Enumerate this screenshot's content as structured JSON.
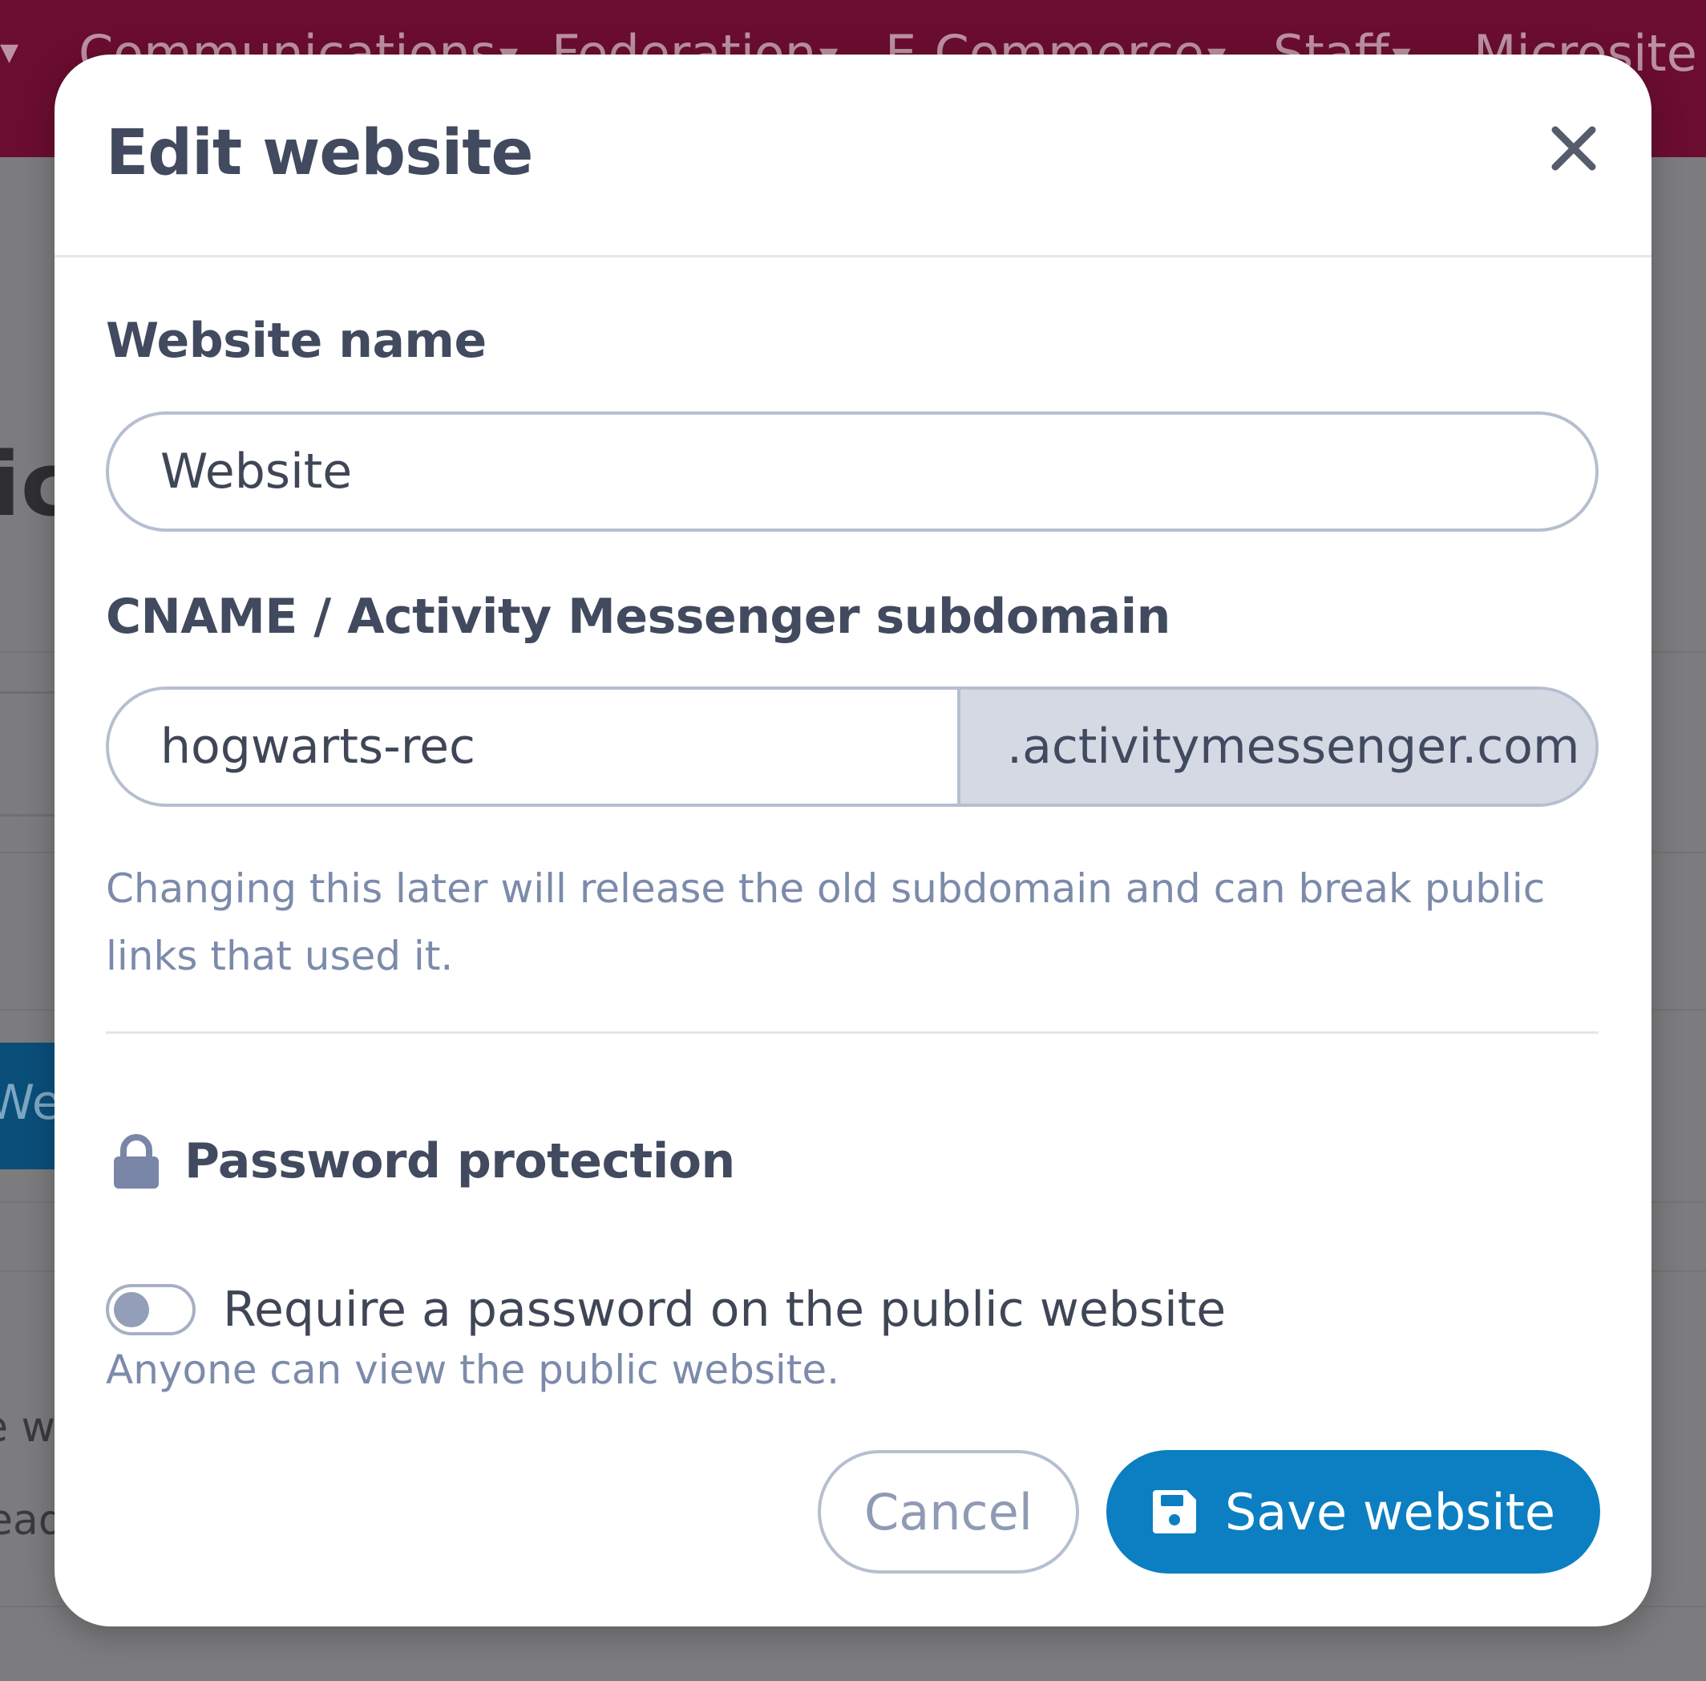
{
  "background": {
    "nav_items": [
      {
        "label": "Communications"
      },
      {
        "label": "Federation"
      },
      {
        "label": "E-Commerce"
      },
      {
        "label": "Staff"
      },
      {
        "label": "Microsite"
      }
    ],
    "fragments": {
      "heading": "ic",
      "button": "We",
      "line1": "e w",
      "line2": "ead"
    },
    "colors": {
      "nav": "#6b0d30",
      "overlay": "#7c7c7e"
    }
  },
  "modal": {
    "title": "Edit website",
    "close_icon": "close-icon",
    "website_name": {
      "label": "Website name",
      "value": "Website"
    },
    "subdomain": {
      "label": "CNAME / Activity Messenger subdomain",
      "value": "hogwarts-rec",
      "suffix": ".activitymessenger.com",
      "help": "Changing this later will release the old subdomain and can break public links that used it."
    },
    "password_protection": {
      "icon": "lock-icon",
      "title": "Password protection",
      "toggle_label": "Require a password on the public website",
      "toggle_on": false,
      "help": "Anyone can view the public website."
    },
    "buttons": {
      "cancel": "Cancel",
      "save": "Save website",
      "save_icon": "floppy-disk-icon"
    },
    "colors": {
      "primary": "#0b7fc1",
      "text": "#414a5e",
      "muted": "#7c8bab",
      "suffix_bg": "#d4d9e4"
    }
  }
}
